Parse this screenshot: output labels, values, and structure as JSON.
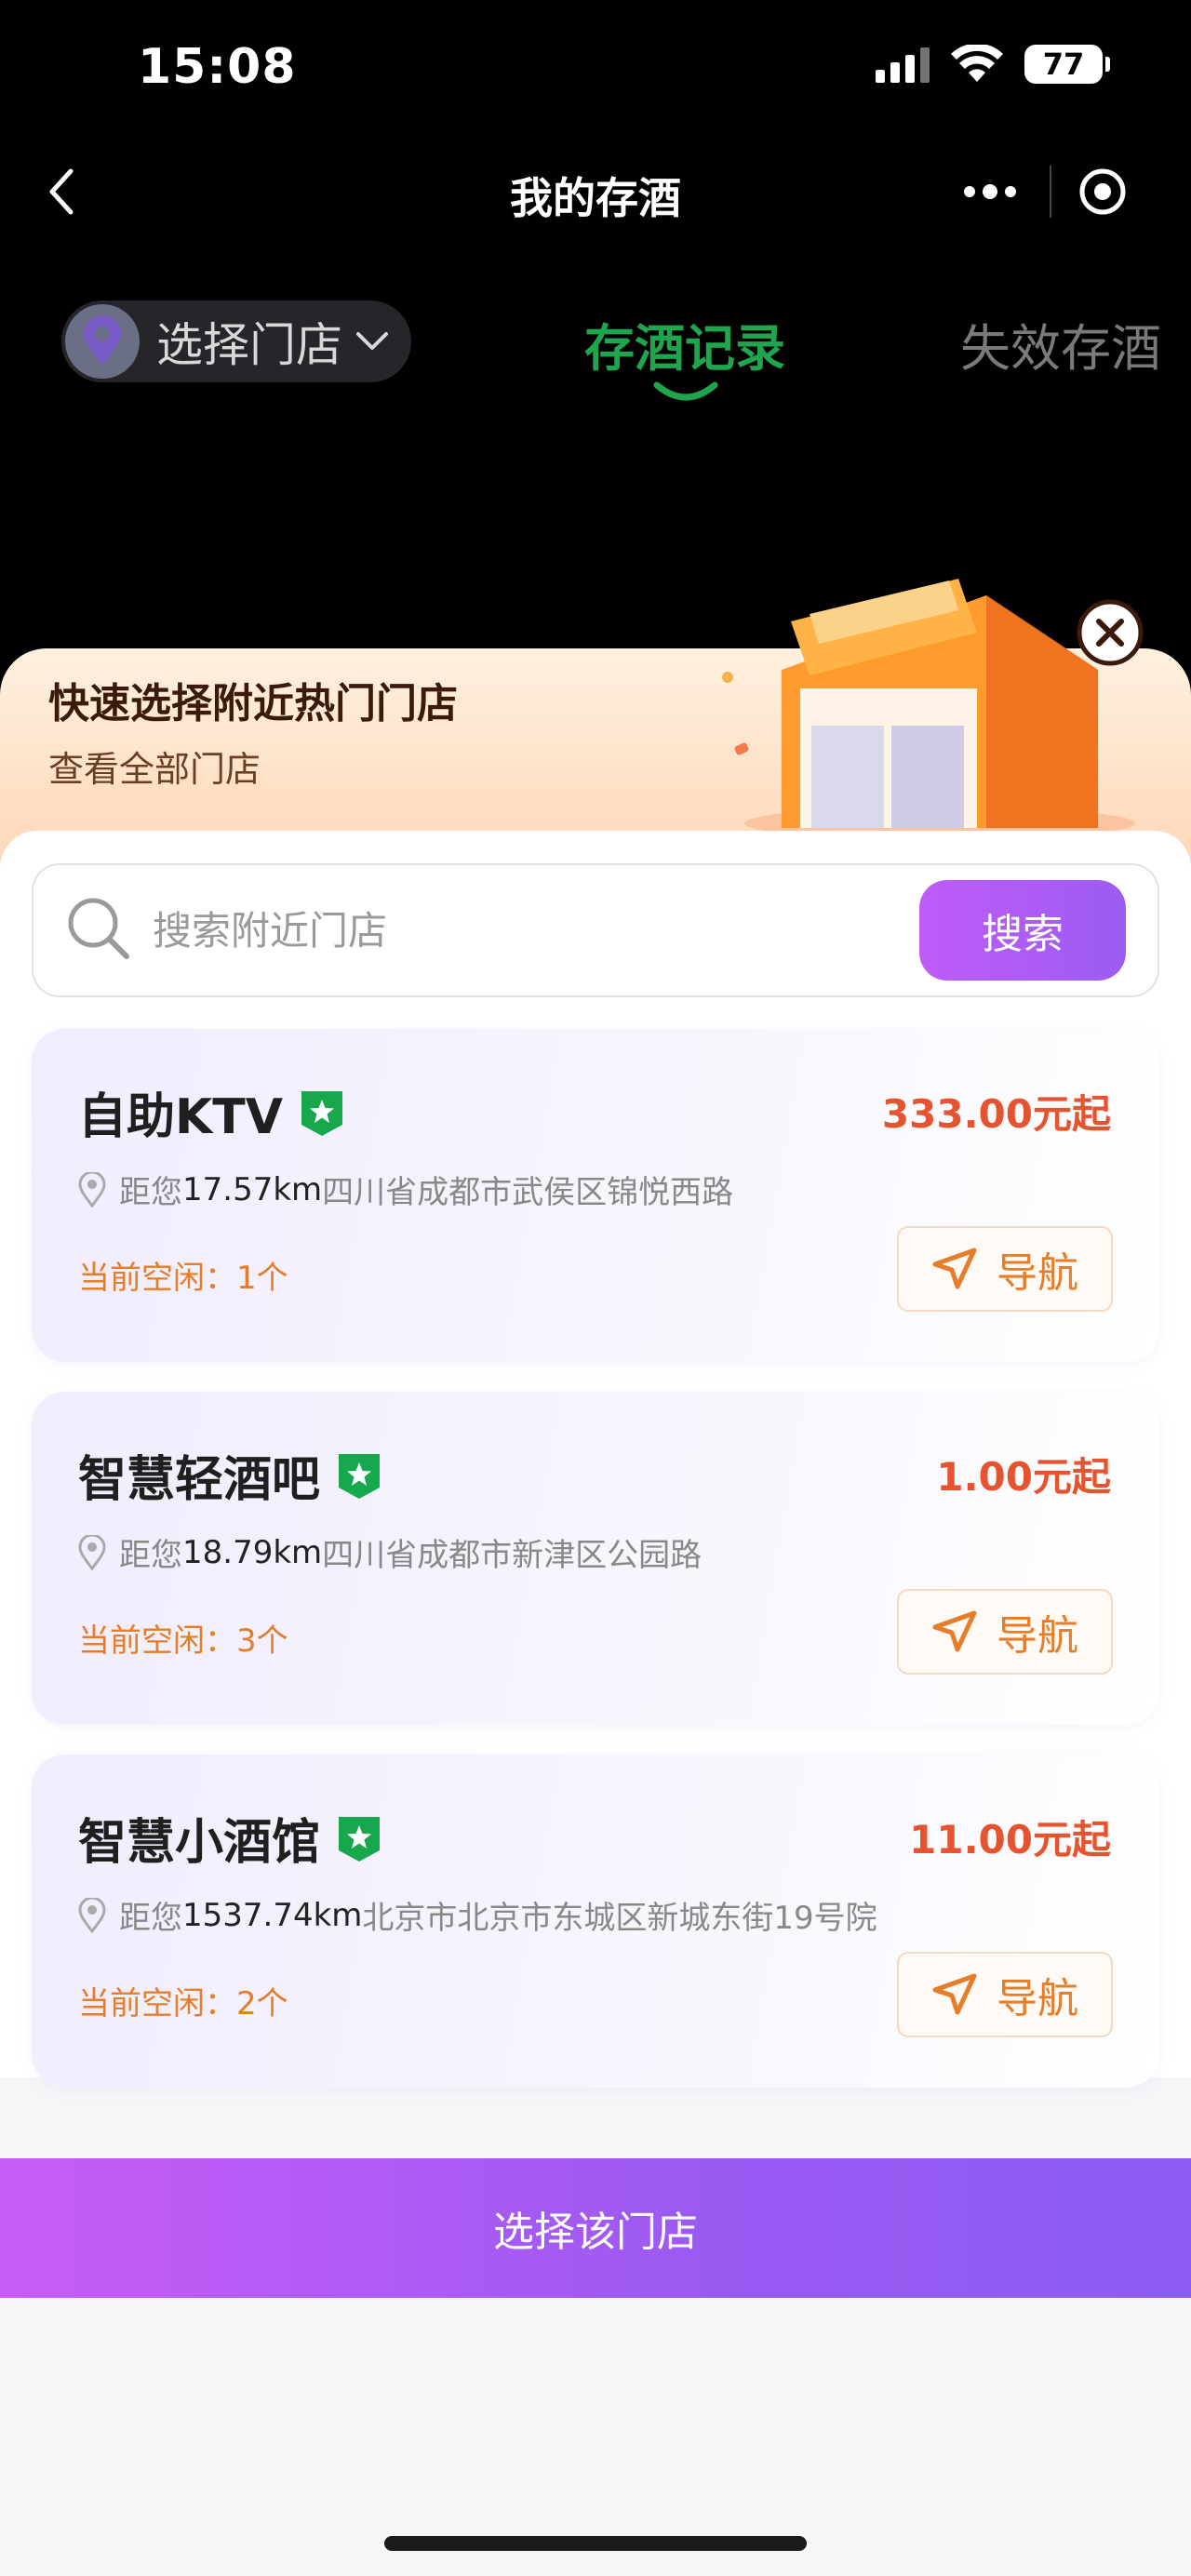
{
  "status_bar": {
    "time": "15:08",
    "battery": "77"
  },
  "nav": {
    "title": "我的存酒"
  },
  "store_selector": {
    "label": "选择门店"
  },
  "tabs": [
    {
      "label": "存酒记录",
      "active": true
    },
    {
      "label": "失效存酒",
      "active": false
    }
  ],
  "banner": {
    "title": "快速选择附近热门门店",
    "subtitle": "查看全部门店"
  },
  "search": {
    "placeholder": "搜索附近门店",
    "button_label": "搜索"
  },
  "stores": [
    {
      "name": "自助KTV",
      "price": "333.00元起",
      "distance_prefix": "距您",
      "distance": "17.57km",
      "address": "四川省成都市武侯区锦悦西路",
      "idle": "当前空闲：1个",
      "nav_label": "导航"
    },
    {
      "name": "智慧轻酒吧",
      "price": "1.00元起",
      "distance_prefix": "距您",
      "distance": "18.79km",
      "address": "四川省成都市新津区公园路",
      "idle": "当前空闲：3个",
      "nav_label": "导航"
    },
    {
      "name": "智慧小酒馆",
      "price": "11.00元起",
      "distance_prefix": "距您",
      "distance": "1537.74km",
      "address": "北京市北京市东城区新城东街19号院",
      "idle": "当前空闲：2个",
      "nav_label": "导航"
    }
  ],
  "bottom_button": {
    "label": "选择该门店"
  },
  "colors": {
    "accent_green": "#1fa54d",
    "price_red": "#e6532f",
    "idle_orange": "#e57d2a",
    "purple_start": "#c85cf6",
    "purple_end": "#8a5cf0"
  }
}
